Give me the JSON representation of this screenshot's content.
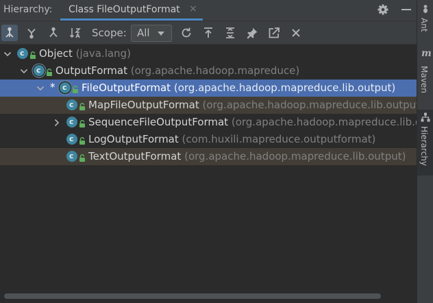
{
  "header": {
    "label": "Hierarchy:",
    "tab_title": "Class FileOutputFormat",
    "tab_close": "×",
    "settings_icon": "gear-icon",
    "minimize_icon": "minimize-icon"
  },
  "toolbar": {
    "buttons": [
      "type-hierarchy-icon",
      "supertypes-hierarchy-icon",
      "subtypes-hierarchy-icon",
      "sort-alphabetically-icon"
    ],
    "scope_label": "Scope:",
    "scope_value": "All",
    "actions": [
      "refresh-icon",
      "export-icon",
      "expand-all-icon",
      "pin-icon",
      "autoscroll-icon",
      "close-icon"
    ]
  },
  "tree": {
    "rows": [
      {
        "name": "Object",
        "package": "(java.lang)",
        "depth": 0,
        "expanded": true,
        "highlight": "none"
      },
      {
        "name": "OutputFormat",
        "package": "(org.apache.hadoop.mapreduce)",
        "depth": 1,
        "expanded": true,
        "highlight": "none",
        "abstract": true
      },
      {
        "name": "FileOutputFormat",
        "package": "(org.apache.hadoop.mapreduce.lib.output)",
        "depth": 2,
        "expanded": true,
        "highlight": "selected",
        "abstract": true,
        "marker": "*"
      },
      {
        "name": "MapFileOutputFormat",
        "package": "(org.apache.hadoop.mapreduce.lib.output)",
        "depth": 3,
        "expanded": false,
        "highlight": "brown"
      },
      {
        "name": "SequenceFileOutputFormat",
        "package": "(org.apache.hadoop.mapreduce.lib.output)",
        "depth": 3,
        "expanded": false,
        "collapsed_arrow": true,
        "highlight": "none"
      },
      {
        "name": "LogOutputFormat",
        "package": "(com.huxili.mapreduce.outputformat)",
        "depth": 3,
        "expanded": false,
        "highlight": "none"
      },
      {
        "name": "TextOutputFormat",
        "package": "(org.apache.hadoop.mapreduce.lib.output)",
        "depth": 3,
        "expanded": false,
        "highlight": "brown"
      }
    ]
  },
  "sidebar": {
    "tabs": [
      {
        "label": "Ant",
        "icon": "ant-icon"
      },
      {
        "label": "Maven",
        "icon": "maven-icon"
      },
      {
        "label": "Hierarchy",
        "icon": "hierarchy-icon"
      }
    ]
  },
  "colors": {
    "selection": "#4b6eaf",
    "highlight_row": "#423e37",
    "class_icon": "#3e86a0",
    "accent": "#4a88c7"
  }
}
